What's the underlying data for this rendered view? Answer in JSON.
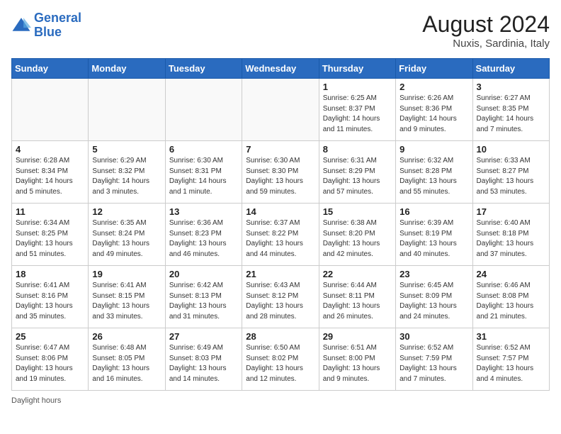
{
  "header": {
    "logo_general": "General",
    "logo_blue": "Blue",
    "month_year": "August 2024",
    "location": "Nuxis, Sardinia, Italy"
  },
  "days_of_week": [
    "Sunday",
    "Monday",
    "Tuesday",
    "Wednesday",
    "Thursday",
    "Friday",
    "Saturday"
  ],
  "footer": {
    "label": "Daylight hours"
  },
  "weeks": [
    [
      {
        "day": "",
        "info": ""
      },
      {
        "day": "",
        "info": ""
      },
      {
        "day": "",
        "info": ""
      },
      {
        "day": "",
        "info": ""
      },
      {
        "day": "1",
        "info": "Sunrise: 6:25 AM\nSunset: 8:37 PM\nDaylight: 14 hours\nand 11 minutes."
      },
      {
        "day": "2",
        "info": "Sunrise: 6:26 AM\nSunset: 8:36 PM\nDaylight: 14 hours\nand 9 minutes."
      },
      {
        "day": "3",
        "info": "Sunrise: 6:27 AM\nSunset: 8:35 PM\nDaylight: 14 hours\nand 7 minutes."
      }
    ],
    [
      {
        "day": "4",
        "info": "Sunrise: 6:28 AM\nSunset: 8:34 PM\nDaylight: 14 hours\nand 5 minutes."
      },
      {
        "day": "5",
        "info": "Sunrise: 6:29 AM\nSunset: 8:32 PM\nDaylight: 14 hours\nand 3 minutes."
      },
      {
        "day": "6",
        "info": "Sunrise: 6:30 AM\nSunset: 8:31 PM\nDaylight: 14 hours\nand 1 minute."
      },
      {
        "day": "7",
        "info": "Sunrise: 6:30 AM\nSunset: 8:30 PM\nDaylight: 13 hours\nand 59 minutes."
      },
      {
        "day": "8",
        "info": "Sunrise: 6:31 AM\nSunset: 8:29 PM\nDaylight: 13 hours\nand 57 minutes."
      },
      {
        "day": "9",
        "info": "Sunrise: 6:32 AM\nSunset: 8:28 PM\nDaylight: 13 hours\nand 55 minutes."
      },
      {
        "day": "10",
        "info": "Sunrise: 6:33 AM\nSunset: 8:27 PM\nDaylight: 13 hours\nand 53 minutes."
      }
    ],
    [
      {
        "day": "11",
        "info": "Sunrise: 6:34 AM\nSunset: 8:25 PM\nDaylight: 13 hours\nand 51 minutes."
      },
      {
        "day": "12",
        "info": "Sunrise: 6:35 AM\nSunset: 8:24 PM\nDaylight: 13 hours\nand 49 minutes."
      },
      {
        "day": "13",
        "info": "Sunrise: 6:36 AM\nSunset: 8:23 PM\nDaylight: 13 hours\nand 46 minutes."
      },
      {
        "day": "14",
        "info": "Sunrise: 6:37 AM\nSunset: 8:22 PM\nDaylight: 13 hours\nand 44 minutes."
      },
      {
        "day": "15",
        "info": "Sunrise: 6:38 AM\nSunset: 8:20 PM\nDaylight: 13 hours\nand 42 minutes."
      },
      {
        "day": "16",
        "info": "Sunrise: 6:39 AM\nSunset: 8:19 PM\nDaylight: 13 hours\nand 40 minutes."
      },
      {
        "day": "17",
        "info": "Sunrise: 6:40 AM\nSunset: 8:18 PM\nDaylight: 13 hours\nand 37 minutes."
      }
    ],
    [
      {
        "day": "18",
        "info": "Sunrise: 6:41 AM\nSunset: 8:16 PM\nDaylight: 13 hours\nand 35 minutes."
      },
      {
        "day": "19",
        "info": "Sunrise: 6:41 AM\nSunset: 8:15 PM\nDaylight: 13 hours\nand 33 minutes."
      },
      {
        "day": "20",
        "info": "Sunrise: 6:42 AM\nSunset: 8:13 PM\nDaylight: 13 hours\nand 31 minutes."
      },
      {
        "day": "21",
        "info": "Sunrise: 6:43 AM\nSunset: 8:12 PM\nDaylight: 13 hours\nand 28 minutes."
      },
      {
        "day": "22",
        "info": "Sunrise: 6:44 AM\nSunset: 8:11 PM\nDaylight: 13 hours\nand 26 minutes."
      },
      {
        "day": "23",
        "info": "Sunrise: 6:45 AM\nSunset: 8:09 PM\nDaylight: 13 hours\nand 24 minutes."
      },
      {
        "day": "24",
        "info": "Sunrise: 6:46 AM\nSunset: 8:08 PM\nDaylight: 13 hours\nand 21 minutes."
      }
    ],
    [
      {
        "day": "25",
        "info": "Sunrise: 6:47 AM\nSunset: 8:06 PM\nDaylight: 13 hours\nand 19 minutes."
      },
      {
        "day": "26",
        "info": "Sunrise: 6:48 AM\nSunset: 8:05 PM\nDaylight: 13 hours\nand 16 minutes."
      },
      {
        "day": "27",
        "info": "Sunrise: 6:49 AM\nSunset: 8:03 PM\nDaylight: 13 hours\nand 14 minutes."
      },
      {
        "day": "28",
        "info": "Sunrise: 6:50 AM\nSunset: 8:02 PM\nDaylight: 13 hours\nand 12 minutes."
      },
      {
        "day": "29",
        "info": "Sunrise: 6:51 AM\nSunset: 8:00 PM\nDaylight: 13 hours\nand 9 minutes."
      },
      {
        "day": "30",
        "info": "Sunrise: 6:52 AM\nSunset: 7:59 PM\nDaylight: 13 hours\nand 7 minutes."
      },
      {
        "day": "31",
        "info": "Sunrise: 6:52 AM\nSunset: 7:57 PM\nDaylight: 13 hours\nand 4 minutes."
      }
    ]
  ]
}
